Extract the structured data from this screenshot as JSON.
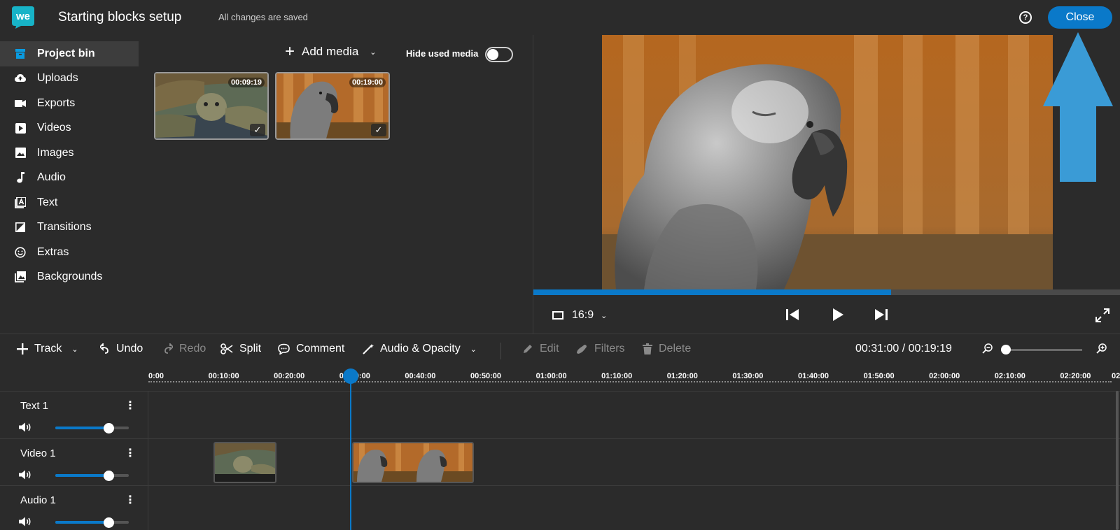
{
  "header": {
    "logo_text": "we",
    "title": "Starting blocks setup",
    "save_status": "All changes are saved",
    "help_label": "?",
    "close_label": "Close",
    "accent_color": "#0a79c9"
  },
  "sidebar": {
    "items": [
      {
        "label": "Project bin",
        "icon": "project-bin-icon",
        "active": true
      },
      {
        "label": "Uploads",
        "icon": "cloud-upload-icon"
      },
      {
        "label": "Exports",
        "icon": "video-camera-icon"
      },
      {
        "label": "Videos",
        "icon": "play-box-icon"
      },
      {
        "label": "Images",
        "icon": "image-icon"
      },
      {
        "label": "Audio",
        "icon": "music-note-icon"
      },
      {
        "label": "Text",
        "icon": "text-icon"
      },
      {
        "label": "Transitions",
        "icon": "transition-icon"
      },
      {
        "label": "Extras",
        "icon": "smiley-icon"
      },
      {
        "label": "Backgrounds",
        "icon": "backgrounds-icon"
      }
    ]
  },
  "media_bin": {
    "add_media_label": "Add media",
    "hide_used_label": "Hide used media",
    "hide_used_enabled": false,
    "items": [
      {
        "subject": "tortoise",
        "duration": "00:09:19",
        "used": true
      },
      {
        "subject": "parrot",
        "duration": "00:19:00",
        "used": true
      }
    ]
  },
  "preview": {
    "subject": "parrot",
    "aspect_ratio": "16:9",
    "progress_fraction": 0.61
  },
  "toolbar": {
    "track_label": "Track",
    "undo_label": "Undo",
    "redo_label": "Redo",
    "split_label": "Split",
    "comment_label": "Comment",
    "audio_opacity_label": "Audio & Opacity",
    "edit_label": "Edit",
    "filters_label": "Filters",
    "delete_label": "Delete",
    "timecode": "00:31:00 / 00:19:19",
    "zoom_level": 0
  },
  "ruler": {
    "ticks": [
      "0:00",
      "00:10:00",
      "00:20:00",
      "00:30:00",
      "00:40:00",
      "00:50:00",
      "01:00:00",
      "01:10:00",
      "01:20:00",
      "01:30:00",
      "01:40:00",
      "01:50:00",
      "02:00:00",
      "02:10:00",
      "02:20:00",
      "02"
    ],
    "playhead": "00:31:00"
  },
  "tracks": [
    {
      "name": "Text 1",
      "volume": 0.73
    },
    {
      "name": "Video 1",
      "volume": 0.73
    },
    {
      "name": "Audio 1",
      "volume": 0.73
    }
  ],
  "clips": [
    {
      "track": "Video 1",
      "subject": "tortoise"
    },
    {
      "track": "Video 1",
      "subject": "parrot"
    }
  ]
}
